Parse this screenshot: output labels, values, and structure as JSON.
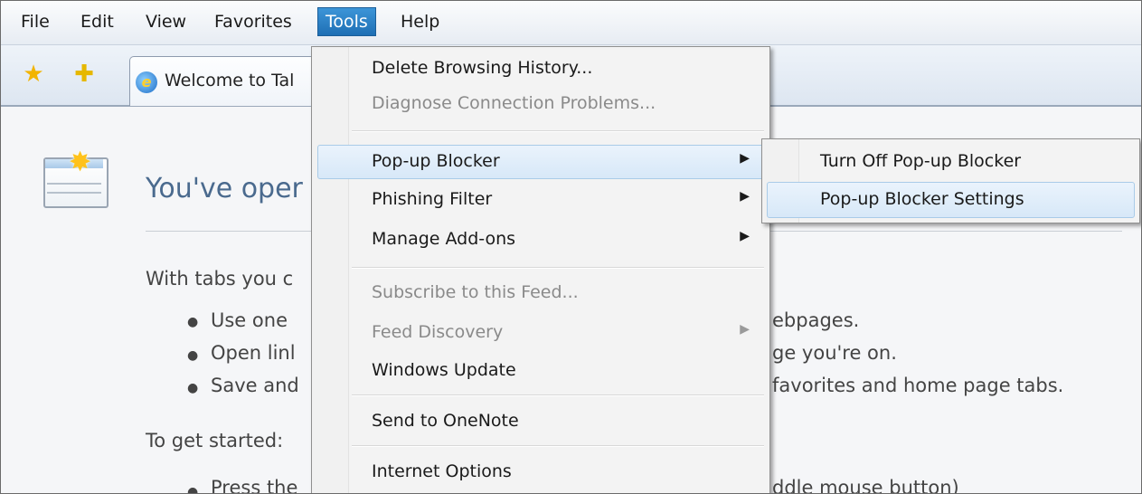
{
  "menubar": {
    "items": [
      {
        "label": "File"
      },
      {
        "label": "Edit"
      },
      {
        "label": "View"
      },
      {
        "label": "Favorites"
      },
      {
        "label": "Tools"
      },
      {
        "label": "Help"
      }
    ],
    "active": "Tools"
  },
  "toolbar": {
    "tab_label": "Welcome to Tal"
  },
  "page": {
    "heading": "You've oper",
    "intro": "With tabs you c",
    "bullets": [
      {
        "left": "Use one",
        "right": "ebpages."
      },
      {
        "left": "Open linl",
        "right": "ge you're on."
      },
      {
        "left": "Save and",
        "right": "favorites and home page tabs."
      }
    ],
    "started": "To get started:",
    "cut_line_left": "Press the",
    "cut_line_right": "ddle mouse button)"
  },
  "tools_menu": {
    "items": [
      {
        "label": "Delete Browsing History...",
        "enabled": true,
        "submenu": false
      },
      {
        "label": "Diagnose Connection Problems...",
        "enabled": false,
        "submenu": false
      },
      {
        "label": "Pop-up Blocker",
        "enabled": true,
        "submenu": true,
        "highlighted": true
      },
      {
        "label": "Phishing Filter",
        "enabled": true,
        "submenu": true
      },
      {
        "label": "Manage Add-ons",
        "enabled": true,
        "submenu": true
      },
      {
        "label": "Subscribe to this Feed...",
        "enabled": false,
        "submenu": false
      },
      {
        "label": "Feed Discovery",
        "enabled": false,
        "submenu": true
      },
      {
        "label": "Windows Update",
        "enabled": true,
        "submenu": false
      },
      {
        "label": "Send to OneNote",
        "enabled": true,
        "submenu": false
      },
      {
        "label": "Internet Options",
        "enabled": true,
        "submenu": false
      }
    ]
  },
  "popup_submenu": {
    "items": [
      {
        "label": "Turn Off Pop-up Blocker"
      },
      {
        "label": "Pop-up Blocker Settings",
        "highlighted": true
      }
    ]
  },
  "colors": {
    "menu_active": "#2a80c6",
    "highlight": "#d7e8f8",
    "heading": "#4a6a8e"
  }
}
